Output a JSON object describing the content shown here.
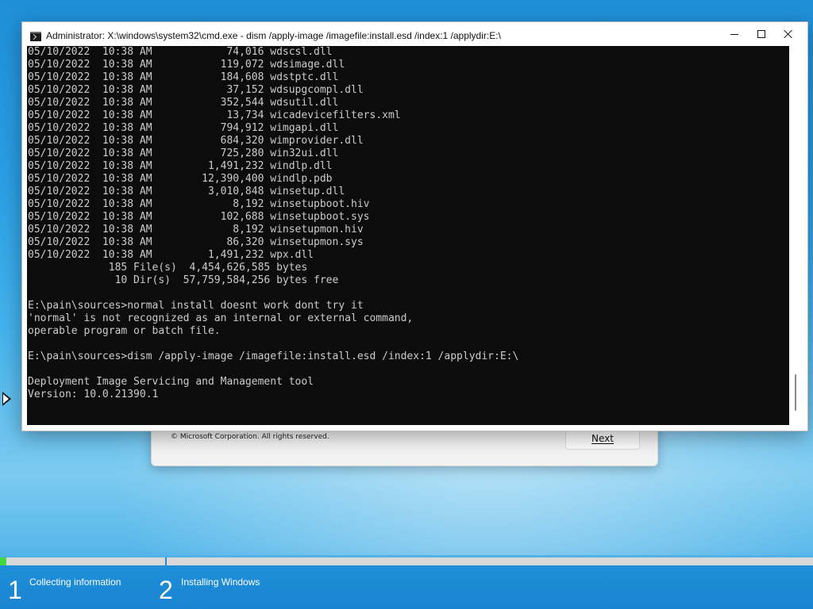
{
  "setup": {
    "copyright": "© Microsoft Corporation. All rights reserved.",
    "next_label": "Next"
  },
  "cmd": {
    "title": "Administrator: X:\\windows\\system32\\cmd.exe - dism  /apply-image /imagefile:install.esd /index:1 /applydir:E:\\",
    "lines": [
      "05/10/2022  10:38 AM            74,016 wdscsl.dll",
      "05/10/2022  10:38 AM           119,072 wdsimage.dll",
      "05/10/2022  10:38 AM           184,608 wdstptc.dll",
      "05/10/2022  10:38 AM            37,152 wdsupgcompl.dll",
      "05/10/2022  10:38 AM           352,544 wdsutil.dll",
      "05/10/2022  10:38 AM            13,734 wicadevicefilters.xml",
      "05/10/2022  10:38 AM           794,912 wimgapi.dll",
      "05/10/2022  10:38 AM           684,320 wimprovider.dll",
      "05/10/2022  10:38 AM           725,280 win32ui.dll",
      "05/10/2022  10:38 AM         1,491,232 windlp.dll",
      "05/10/2022  10:38 AM        12,390,400 windlp.pdb",
      "05/10/2022  10:38 AM         3,010,848 winsetup.dll",
      "05/10/2022  10:38 AM             8,192 winsetupboot.hiv",
      "05/10/2022  10:38 AM           102,688 winsetupboot.sys",
      "05/10/2022  10:38 AM             8,192 winsetupmon.hiv",
      "05/10/2022  10:38 AM            86,320 winsetupmon.sys",
      "05/10/2022  10:38 AM         1,491,232 wpx.dll",
      "             185 File(s)  4,454,626,585 bytes",
      "              10 Dir(s)  57,759,584,256 bytes free",
      "",
      "E:\\pain\\sources>normal install doesnt work dont try it",
      "'normal' is not recognized as an internal or external command,",
      "operable program or batch file.",
      "",
      "E:\\pain\\sources>dism /apply-image /imagefile:install.esd /index:1 /applydir:E:\\",
      "",
      "Deployment Image Servicing and Management tool",
      "Version: 10.0.21390.1"
    ]
  },
  "steps": [
    {
      "number": "1",
      "label": "Collecting information"
    },
    {
      "number": "2",
      "label": "Installing Windows"
    }
  ],
  "progress": {
    "fraction": 0.008
  }
}
